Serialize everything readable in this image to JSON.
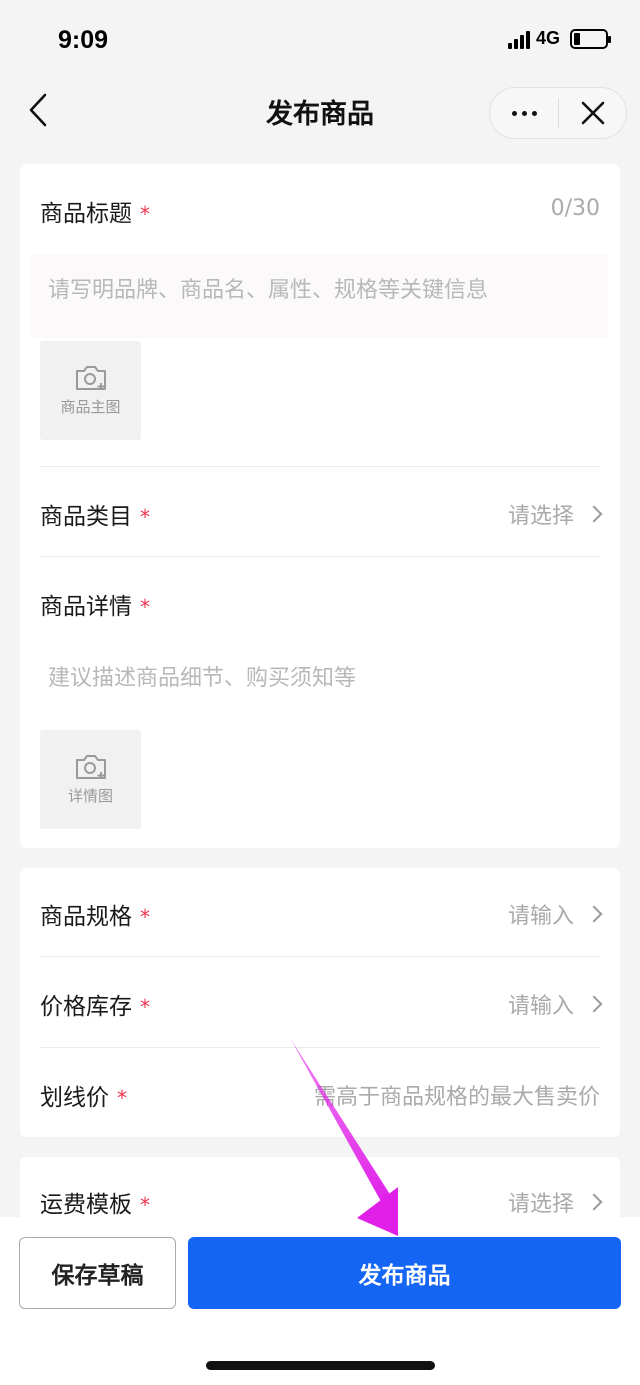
{
  "status_bar": {
    "time": "9:09",
    "network": "4G",
    "battery_level": 0.2
  },
  "nav": {
    "title": "发布商品"
  },
  "basic_info": {
    "title_field": {
      "label": "商品标题",
      "required_mark": "*",
      "counter": "0/30",
      "placeholder": "请写明品牌、商品名、属性、规格等关键信息"
    },
    "main_image": {
      "label": "商品主图",
      "icon": "camera-plus-icon"
    },
    "category": {
      "label": "商品类目",
      "required_mark": "*",
      "value": "请选择"
    },
    "details": {
      "label": "商品详情",
      "required_mark": "*",
      "placeholder": "建议描述商品细节、购买须知等"
    },
    "detail_image": {
      "label": "详情图",
      "icon": "camera-plus-icon"
    }
  },
  "pricing": {
    "spec": {
      "label": "商品规格",
      "required_mark": "*",
      "value": "请输入"
    },
    "stock": {
      "label": "价格库存",
      "required_mark": "*",
      "value": "请输入"
    },
    "strike_price": {
      "label": "划线价",
      "required_mark": "*",
      "value": "需高于商品规格的最大售卖价"
    }
  },
  "shipping": {
    "template": {
      "label": "运费模板",
      "required_mark": "*",
      "value": "请选择"
    }
  },
  "actions": {
    "save_draft": "保存草稿",
    "publish": "发布商品"
  },
  "colors": {
    "primary": "#1565f5",
    "required": "#f0334f",
    "annotation_arrow": "#e020e8"
  }
}
